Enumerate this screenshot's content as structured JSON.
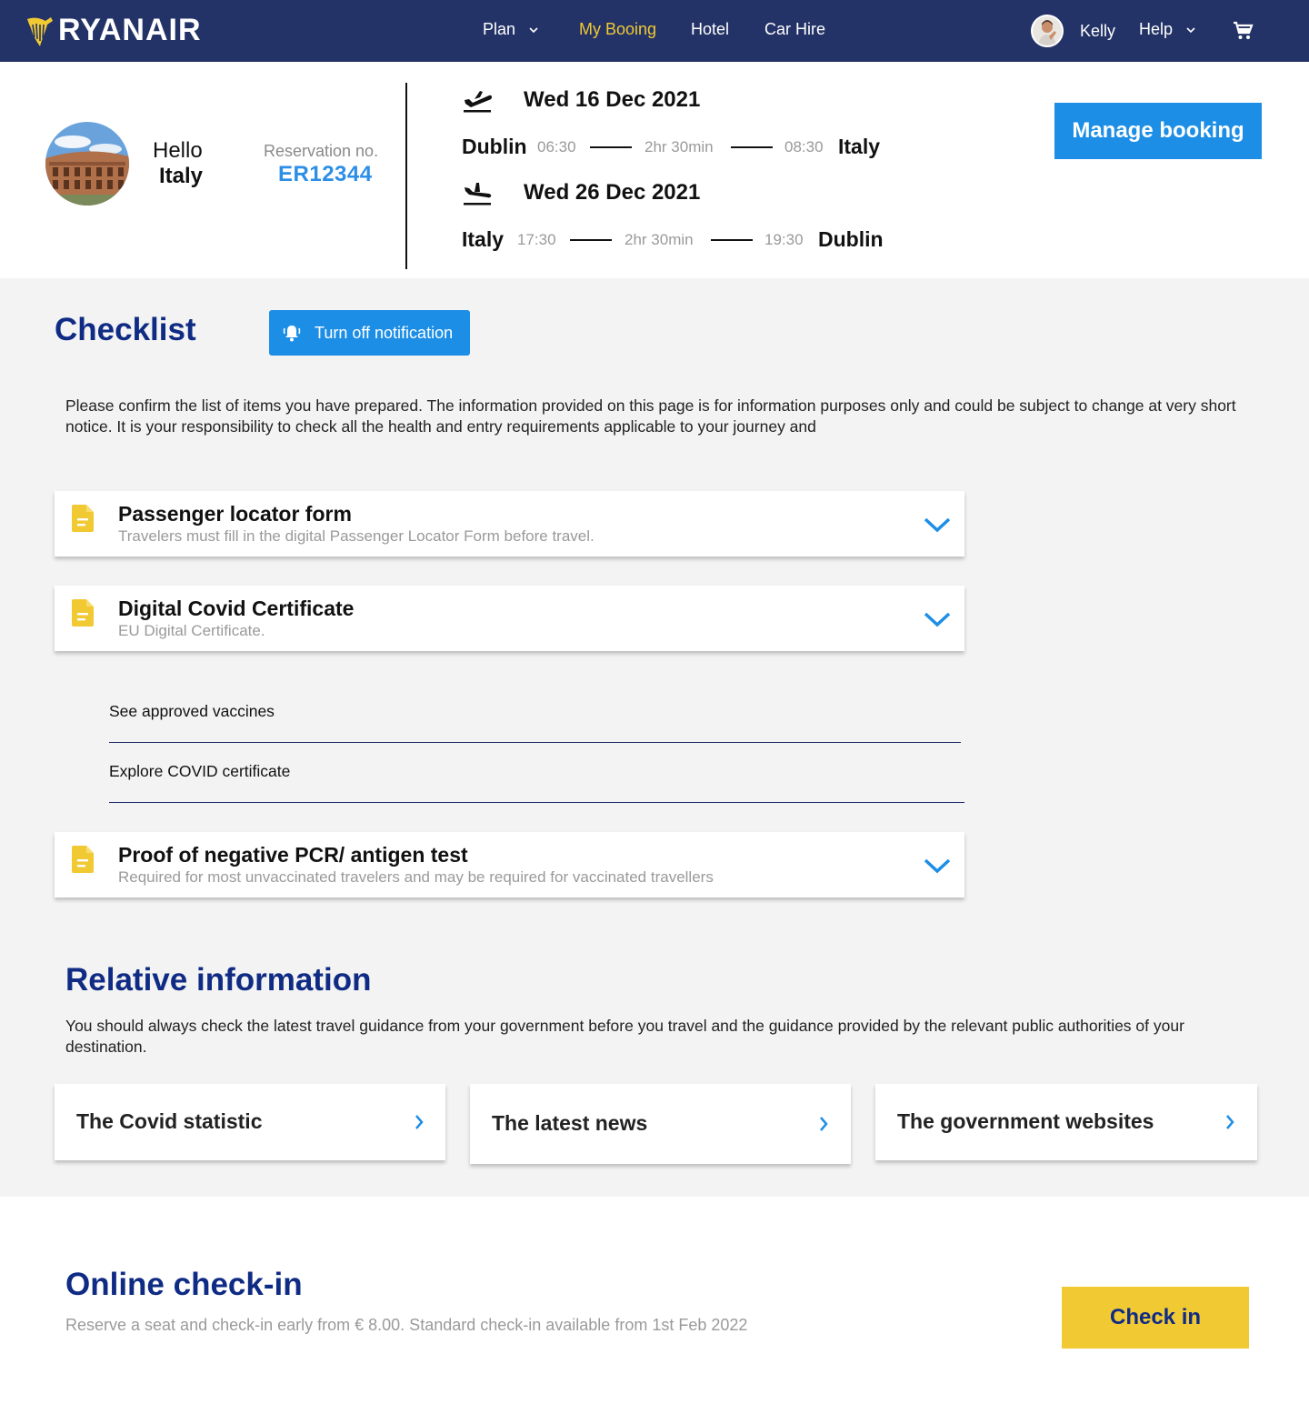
{
  "header": {
    "brand": "RYANAIR",
    "nav": [
      {
        "label": "Plan",
        "dropdown": true
      },
      {
        "label": "My Booing",
        "active": true
      },
      {
        "label": "Hotel"
      },
      {
        "label": "Car Hire"
      }
    ],
    "user_name": "Kelly",
    "help_label": "Help",
    "cart_icon": "cart-icon"
  },
  "summary": {
    "greeting": "Hello",
    "destination_name": "Italy",
    "reservation_label": "Reservation no.",
    "reservation_number": "ER12344",
    "outbound": {
      "date": "Wed 16 Dec 2021",
      "from": "Dublin",
      "depart": "06:30",
      "duration": "2hr 30min",
      "arrive": "08:30",
      "to": "Italy"
    },
    "return": {
      "date": "Wed 26 Dec 2021",
      "from": "Italy",
      "depart": "17:30",
      "duration": "2hr 30min",
      "arrive": "19:30",
      "to": "Dublin"
    },
    "manage_button": "Manage booking"
  },
  "checklist": {
    "title": "Checklist",
    "notification_button": "Turn off notification",
    "description": "Please confirm the list of items you have prepared. The information provided on this page is for information purposes only and could be subject to change at very short notice. It is your responsibility to check all the health and entry requirements applicable to your journey and",
    "items": [
      {
        "title": "Passenger locator form",
        "subtitle": "Travelers must fill in the digital Passenger Locator Form before travel."
      },
      {
        "title": "Digital Covid Certificate",
        "subtitle": "EU Digital Certificate."
      },
      {
        "title": "Proof of negative PCR/ antigen test",
        "subtitle": "Required for most unvaccinated travelers and may be required for vaccinated travellers"
      }
    ],
    "sub_links": [
      "See approved vaccines",
      "Explore COVID certificate"
    ]
  },
  "relative": {
    "title": "Relative information",
    "description": "You should always check the latest travel guidance from your government before you travel and the guidance provided by the relevant public authorities of your destination.",
    "cards": [
      "The Covid statistic",
      "The latest news",
      "The government websites"
    ]
  },
  "checkin": {
    "title": "Online check-in",
    "subtitle": "Reserve a seat and check-in early from € 8.00. Standard check-in available from 1st Feb 2022",
    "button": "Check in"
  },
  "colors": {
    "brand_navy": "#243367",
    "accent_yellow": "#f1c933",
    "primary_blue": "#1d8ee6",
    "heading_blue": "#0f2b84"
  }
}
